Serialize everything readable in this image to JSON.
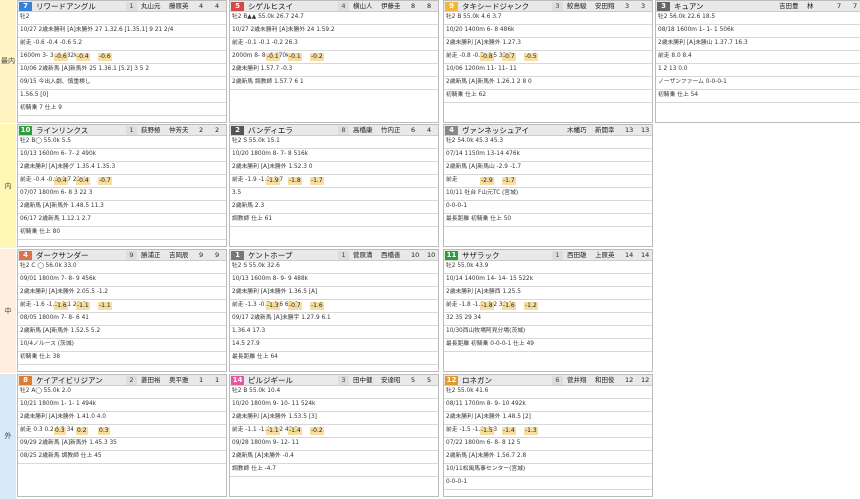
{
  "bands": [
    "最内",
    "内",
    "中",
    "外"
  ],
  "cards": [
    {
      "no": "7",
      "no_color": "#3b7fd4",
      "name": "リワードアングル",
      "badge": "1",
      "jockey": "丸山元",
      "jockey2": "藤原英",
      "n1": "4",
      "n2": "4",
      "lines": [
        "牡2",
        "10/27 2歳未勝利 [A]未勝外 27 1.32.6 [1.35.1] 9 21 2/4",
        "前走 -0.6 -0.4 -0.6 5.2",
        "1600m 3- 3- 4 482k",
        "10/06 2歳新馬 [A]新馬外 25 1.36.1 [5.2] 3 5 2",
        "09/15 今出入劇、慎重検し",
        "1.56.5 [0]",
        "初騎乗 7 仕上 9"
      ],
      "chips": [
        "-0.6",
        "-0.4",
        "-0.6"
      ]
    },
    {
      "no": "5",
      "no_color": "#d04a4a",
      "name": "シゲルヒスイ",
      "badge": "4",
      "jockey": "横山人",
      "jockey2": "伊藤圭",
      "n1": "8",
      "n2": "8",
      "lines": [
        "牡2 B▲▲ 55.0k 26.7 24.7",
        "10/27 2歳未勝利 [A]未勝外 24 1.59.2",
        "前走 -0.1 -0.1 -0.2 26.3",
        "2000m 8- 8- 6 470k",
        "2歳未勝利 1.57.7 -0.3",
        "2歳新馬 調教師 1.57.7 6 1"
      ],
      "chips": [
        "-0.1",
        "-0.1",
        "-0.2"
      ]
    },
    {
      "no": "9",
      "no_color": "#f0b840",
      "name": "タキシードジャンク",
      "badge": "3",
      "jockey": "鮫島駿",
      "jockey2": "安田翔",
      "n1": "3",
      "n2": "3",
      "lines": [
        "牡2 B 55.0k 4.6 3.7",
        "10/20 1400m 6- 8 486k",
        "2歳未勝利 [A]未勝外 1.27.3",
        "前走 -0.8 -0.7 -0.5 33.6",
        "10/06 1200m 11- 11- 11",
        "2歳新馬 [A]新馬外 1.26.1 2 8 0",
        "初騎乗 仕上 62"
      ],
      "chips": [
        "-0.8",
        "-0.7",
        "-0.5"
      ]
    },
    {
      "no": "3",
      "no_color": "#666666",
      "name": "キュアン",
      "badge": "",
      "jockey": "吉田豊",
      "jockey2": "林",
      "n1": "7",
      "n2": "7",
      "lines": [
        "牡2 56.0k 22.6 18.5",
        "08/18 1600m 1- 1- 1 506k",
        "2歳未勝利 [A]未勝山 1.37.7 16.3",
        "前走 8.0 8.4",
        "1 2 13 0.0",
        "ノーザンファーム 0-0-0-1",
        "初騎乗 仕上 54"
      ],
      "chips": [
        "",
        "",
        ""
      ]
    },
    {
      "no": "10",
      "no_color": "#2b9d3a",
      "name": "ラインリンクス",
      "badge": "1",
      "jockey": "荻野極",
      "jockey2": "仲芳夫",
      "n1": "2",
      "n2": "2",
      "lines": [
        "牡2 B◯ 55.0k 5.5",
        "10/13 1600m 6- 7- 2 490k",
        "2歳未勝利 [A]未勝グ 1.35.4 1.35.3",
        "前走 -0.4 -0.4 -0.7 29.4",
        "07/07 1800m 6- 8 3 22 3",
        "2歳新馬 [A]新馬外 1.48.5 11.3",
        "06/17 2歳新馬 1.12.1 2.7",
        "初騎乗 仕上 80"
      ],
      "chips": [
        "-0.4",
        "-0.4",
        "-0.7"
      ]
    },
    {
      "no": "2",
      "no_color": "#555555",
      "name": "バンディエラ",
      "badge": "8",
      "jockey": "高橋康",
      "jockey2": "竹内正",
      "n1": "6",
      "n2": "4",
      "lines": [
        "牡2 S 55.0k 15.1",
        "10/20 1800m 8- 7- 8 516k",
        "2歳未勝利 [A]未勝外 1.52.3 0",
        "前走 -1.9 -1.8 -1.7",
        "3.5",
        "2歳新馬 2.3",
        "調教師 仕上 61"
      ],
      "chips": [
        "-1.9",
        "-1.8",
        "-1.7"
      ]
    },
    {
      "no": "4",
      "no_color": "#888888",
      "name": "ヴァンネッシュアイ",
      "badge": "",
      "jockey": "木幡巧",
      "jockey2": "新開幸",
      "n1": "13",
      "n2": "13",
      "lines": [
        "牡2 54.0k 45.3 45.3",
        "07/14 1150m 13-14 476k",
        "2歳新馬 [A]新馬山 -2.9 -1.7",
        "前走",
        "10/11 牡台 F山元TC (宮城)",
        "0-0-0-1",
        "最長距離 初騎乗 仕上 50"
      ],
      "chips": [
        "-2.9",
        "-1.7",
        ""
      ]
    },
    {
      "no": "4",
      "no_color": "#e0704a",
      "name": "ダークサンダー",
      "badge": "9",
      "jockey": "勝浦正",
      "jockey2": "吉岡辰",
      "n1": "9",
      "n2": "9",
      "lines": [
        "牡2 C ◯ 56.0k 33.0",
        "09/01 1800m 7- 8- 9 456k",
        "2歳未勝利 [A]未勝外 2.05.5 -1.2",
        "前走 -1.6 -1.1 -1.1 20.6",
        "08/05 1800m 7- 8- 6 41",
        "2歳新馬 [A]新馬外 1.52.5 5.2",
        "10/4ノルース (茨城)",
        "初騎乗 仕上 38"
      ],
      "chips": [
        "-1.6",
        "-1.1",
        "-1.1"
      ]
    },
    {
      "no": "1",
      "no_color": "#777777",
      "name": "ケントホープ",
      "badge": "1",
      "jockey": "菅原満",
      "jockey2": "西橋善",
      "n1": "10",
      "n2": "10",
      "lines": [
        "牡2 S 55.0k 32.6",
        "10/13 1600m 8- 9- 9 488k",
        "2歳未勝利 [A]未勝外 1.36.5 [A]",
        "前走 -1.3 -0.7 -1.6 62.6",
        "09/17 2歳新馬 [A]未勝宇 1.27.9 6.1",
        "1.36.4 17.3",
        "14.5 27.9",
        "最長距離 仕上 64"
      ],
      "chips": [
        "-1.3",
        "-0.7",
        "-1.6"
      ]
    },
    {
      "no": "11",
      "no_color": "#2b9d3a",
      "name": "サザラック",
      "badge": "1",
      "jockey": "西田雄",
      "jockey2": "上原英",
      "n1": "14",
      "n2": "14",
      "lines": [
        "牡2 55.0k 43.9",
        "10/14 1400m 14- 14- 15 522k",
        "2歳未勝利 [A]未勝西 1.25.5",
        "前走 -1.8 -1.6 -1.2 38.6",
        "32 35 29 34",
        "10/30西山牧場阿見分場(茨城)",
        "最長距離 初騎乗 0-0-0-1 仕上 49"
      ],
      "chips": [
        "-1.8",
        "-1.6",
        "-1.2"
      ]
    },
    {
      "no": "8",
      "no_color": "#e07a30",
      "name": "ケイアイビリジアン",
      "badge": "2",
      "jockey": "菱田裕",
      "jockey2": "奥平雅",
      "n1": "1",
      "n2": "1",
      "lines": [
        "牡2 A◯ 55.0k 2.0",
        "10/21 1800m 1- 1- 1 494k",
        "2歳未勝利 [A]未勝外 1.41.0 4.0",
        "前走 0.3 0.2 0.3 34",
        "09/29 2歳新馬 [A]新馬外 1.45.3 35",
        "08/25 2歳新馬 調教師 仕上 45"
      ],
      "chips": [
        "0.3",
        "0.2",
        "0.3"
      ]
    },
    {
      "no": "14",
      "no_color": "#e05aa0",
      "name": "ピルジギール",
      "badge": "3",
      "jockey": "田中健",
      "jockey2": "安達昭",
      "n1": "5",
      "n2": "5",
      "lines": [
        "牡2 B 55.0k 10.4",
        "10/20 1800m 9- 10- 11 524k",
        "2歳未勝利 [A]未勝外 1.53.5 [3]",
        "前走 -1.1 -1.4 -0.2 40.9",
        "09/28 1800m 9- 12- 11",
        "2歳新馬 [A]未勝外 -0.4",
        "調教師 仕上 -4.7"
      ],
      "chips": [
        "-1.1",
        "-1.4",
        "-0.2"
      ]
    },
    {
      "no": "12",
      "no_color": "#e09a30",
      "name": "ロネガン",
      "badge": "6",
      "jockey": "菅井翔",
      "jockey2": "和田俊",
      "n1": "12",
      "n2": "12",
      "lines": [
        "牡2 55.0k 41.6",
        "08/11 1700m 8- 9- 10 492k",
        "2歳未勝利 [A]未勝外 1.48.5 [2]",
        "前走 -1.5 -1.4 -1.3",
        "07/22 1800m 6- 8- 8 12 5",
        "2歳新馬 [A]未勝外 1.56.7 2.8",
        "10/11松風馬事センター(宮城)",
        "0-0-0-1"
      ],
      "chips": [
        "-1.5",
        "-1.4",
        "-1.3"
      ]
    }
  ]
}
